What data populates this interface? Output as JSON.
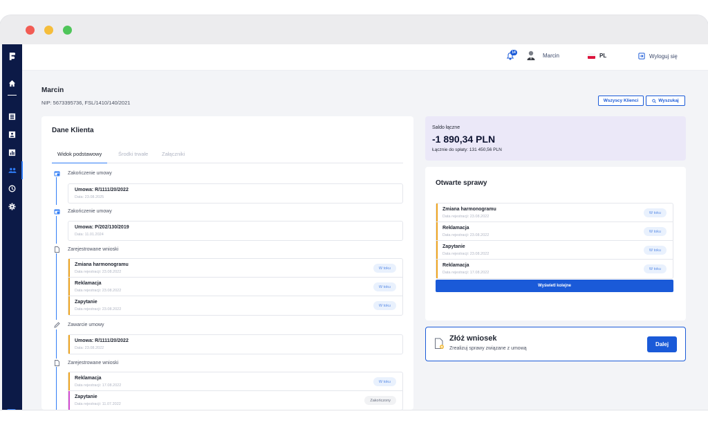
{
  "topbar": {
    "notification_count": "14",
    "user_name": "Marcin",
    "language": "PL",
    "logout_label": "Wyloguj się"
  },
  "client": {
    "name": "Marcin",
    "nip": "NIP: 5673395736, FSL/1410/140/2021"
  },
  "actions": {
    "all_clients": "Wszyscy Klienci",
    "search": "Wyszukaj"
  },
  "client_data": {
    "title": "Dane Klienta",
    "tabs": [
      "Widok podstawowy",
      "Środki trwałe",
      "Załączniki"
    ],
    "timeline": [
      {
        "label": "Zakończenie umowy",
        "icon": "calendar-icon",
        "items": [
          {
            "title": "Umowa: R/1111/20/2022",
            "sub": "Data: 23.08.2025",
            "accent": ""
          }
        ]
      },
      {
        "label": "Zakończenie umowy",
        "icon": "calendar-icon",
        "items": [
          {
            "title": "Umowa: P/202/130/2019",
            "sub": "Data: 11.01.2024",
            "accent": ""
          }
        ]
      },
      {
        "label": "Zarejestrowane wnioski",
        "icon": "document-icon",
        "items": [
          {
            "title": "Zmiana harmonogramu",
            "sub": "Data rejestracji: 23.08.2022",
            "badge": "W toku",
            "accent": "#f0a51f"
          },
          {
            "title": "Reklamacja",
            "sub": "Data rejestracji: 23.08.2022",
            "badge": "W toku",
            "accent": "#f0a51f"
          },
          {
            "title": "Zapytanie",
            "sub": "Data rejestracji: 23.08.2022",
            "badge": "W toku",
            "accent": "#f0a51f"
          }
        ]
      },
      {
        "label": "Zawarcie umowy",
        "icon": "pen-icon",
        "items": [
          {
            "title": "Umowa: R/1111/20/2022",
            "sub": "Data: 23.08.2022",
            "accent": "#f0a51f"
          }
        ]
      },
      {
        "label": "Zarejestrowane wnioski",
        "icon": "document-icon",
        "items": [
          {
            "title": "Reklamacja",
            "sub": "Data rejestracji: 17.08.2022",
            "badge": "W toku",
            "accent": "#f0a51f"
          },
          {
            "title": "Zapytanie",
            "sub": "Data rejestracji: 11.07.2022",
            "badge": "Zakończony",
            "accent": "#d44bd1"
          }
        ]
      }
    ]
  },
  "balance": {
    "label": "Saldo łączne",
    "value": "-1 890,34 PLN",
    "sub": "Łącznie do spłaty: 131 450,56 PLN"
  },
  "open_cases": {
    "title": "Otwarte sprawy",
    "items": [
      {
        "title": "Zmiana harmonogramu",
        "sub": "Data rejestracji: 23.08.2022",
        "badge": "W toku"
      },
      {
        "title": "Reklamacja",
        "sub": "Data rejestracji: 23.08.2022",
        "badge": "W toku"
      },
      {
        "title": "Zapytanie",
        "sub": "Data rejestracji: 23.08.2022",
        "badge": "W toku"
      },
      {
        "title": "Reklamacja",
        "sub": "Data rejestracji: 17.08.2022",
        "badge": "W toku"
      }
    ],
    "more_label": "Wyświetl kolejne"
  },
  "request": {
    "title": "Złóż wniosek",
    "sub": "Zrealizuj sprawy związane z umową",
    "button": "Dalej"
  },
  "colors": {
    "accent": "#1a5ad8",
    "sidebar": "#0c1a47",
    "pending": "#f0a51f",
    "closed": "#d44bd1",
    "balance_bg": "#ebe8f8"
  }
}
